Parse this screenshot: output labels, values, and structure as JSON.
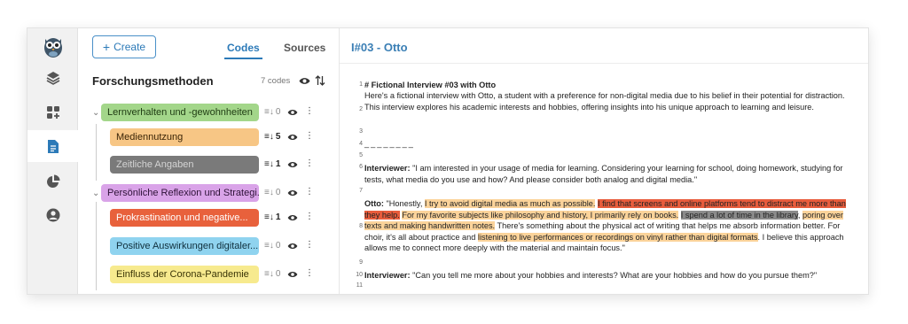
{
  "codes_panel": {
    "create_label": "Create",
    "tab_codes": "Codes",
    "tab_sources": "Sources",
    "title": "Forschungsmethoden",
    "count": "7 codes",
    "items": [
      {
        "label": "Lernverhalten und -gewohnheiten",
        "count": "0",
        "color": "#a3d68a",
        "level": 0,
        "expanded": true
      },
      {
        "label": "Mediennutzung",
        "count": "5",
        "color": "#f7c685",
        "level": 1
      },
      {
        "label": "Zeitliche Angaben",
        "count": "1",
        "color": "#7a7a7a",
        "level": 1
      },
      {
        "label": "Persönliche Reflexion und Strategi...",
        "count": "0",
        "color": "#d9a3e8",
        "level": 0,
        "expanded": true
      },
      {
        "label": "Prokrastination und negative...",
        "count": "1",
        "color": "#e8613c",
        "level": 1
      },
      {
        "label": "Positive Auswirkungen digitaler...",
        "count": "0",
        "color": "#8fd3ef",
        "level": 1
      },
      {
        "label": "Einfluss der Corona-Pandemie",
        "count": "0",
        "color": "#f7ea8e",
        "level": 1
      }
    ]
  },
  "document": {
    "title": "I#03 - Otto",
    "line_numbers": [
      "1",
      "2",
      "3",
      "4",
      "5",
      "6",
      "7",
      "8",
      "9",
      "10",
      "11"
    ],
    "heading": "# Fictional Interview #03 with Otto",
    "intro": "Here's a fictional interview with Otto, a student with a preference for non-digital media due to his belief in their potential for distraction. This interview explores his academic interests and hobbies, offering insights into his unique approach to learning and leisure.",
    "separator": "________",
    "q1_speaker": "Interviewer:",
    "q1_text": " \"I am interested in your usage of media for learning. Considering your learning for school, doing homework, studying for tests, what media do you use and how? And please consider both analog and digital media.\"",
    "a1_speaker": "Otto:",
    "a1_segments": [
      {
        "text": " \"Honestly, ",
        "hl": "none"
      },
      {
        "text": "I try to avoid digital media as much as possible.",
        "hl": "orange"
      },
      {
        "text": " ",
        "hl": "none"
      },
      {
        "text": "I find that screens and online platforms tend to distract me more than they help.",
        "hl": "red"
      },
      {
        "text": " ",
        "hl": "none"
      },
      {
        "text": "For my favorite subjects like philosophy and history, I primarily rely on books.",
        "hl": "orange"
      },
      {
        "text": " ",
        "hl": "none"
      },
      {
        "text": "I spend a lot of time in the library",
        "hl": "gray"
      },
      {
        "text": ", ",
        "hl": "none"
      },
      {
        "text": "poring over texts and making handwritten notes.",
        "hl": "orange"
      },
      {
        "text": " There's something about the physical act of writing that helps me absorb information better. For choir, it's all about practice and ",
        "hl": "none"
      },
      {
        "text": "listening to live performances or recordings on vinyl rather than digital formats",
        "hl": "orange"
      },
      {
        "text": ". I believe this approach allows me to connect more deeply with the material and maintain focus.\"",
        "hl": "none"
      }
    ],
    "q2_speaker": "Interviewer:",
    "q2_text": " \"Can you tell me more about your hobbies and interests? What are your hobbies and how do you pursue them?\""
  },
  "colors": {
    "accent": "#2c7ab8",
    "highlight_orange": "#fbd39a",
    "highlight_red": "#e85c3c",
    "highlight_gray": "#8a8a8a"
  },
  "icons": [
    "owl-logo-icon",
    "layers-icon",
    "grid-plus-icon",
    "document-icon",
    "pie-chart-icon",
    "user-icon",
    "plus-icon",
    "eye-icon",
    "sort-icon",
    "chevron-down-icon",
    "kebab-icon",
    "code-count-icon"
  ]
}
